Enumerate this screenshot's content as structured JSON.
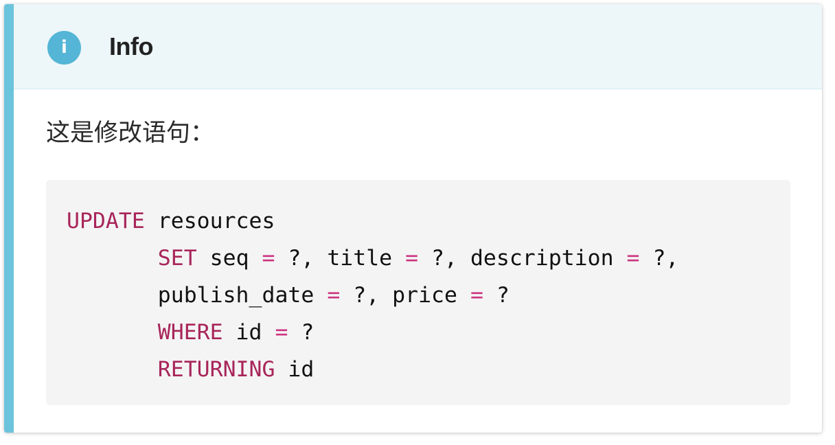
{
  "admonition": {
    "title": "Info",
    "icon": "info-icon",
    "icon_glyph": "i",
    "accent_color": "#6cc3dc",
    "header_bg": "#edf6f9",
    "icon_color": "#54b5d6"
  },
  "content": {
    "lead_text": "这是修改语句："
  },
  "code": {
    "language": "sql",
    "keyword_color": "#a8255a",
    "lines": [
      {
        "indent": "",
        "tokens": [
          {
            "t": "kw",
            "v": "UPDATE"
          },
          {
            "t": "tx",
            "v": " resources"
          }
        ]
      },
      {
        "indent": "       ",
        "tokens": [
          {
            "t": "kw",
            "v": "SET"
          },
          {
            "t": "tx",
            "v": " seq "
          },
          {
            "t": "op",
            "v": "="
          },
          {
            "t": "tx",
            "v": " ?, title "
          },
          {
            "t": "op",
            "v": "="
          },
          {
            "t": "tx",
            "v": " ?, description "
          },
          {
            "t": "op",
            "v": "="
          },
          {
            "t": "tx",
            "v": " ?,"
          }
        ]
      },
      {
        "indent": "       ",
        "tokens": [
          {
            "t": "tx",
            "v": "publish_date "
          },
          {
            "t": "op",
            "v": "="
          },
          {
            "t": "tx",
            "v": " ?, price "
          },
          {
            "t": "op",
            "v": "="
          },
          {
            "t": "tx",
            "v": " ?"
          }
        ]
      },
      {
        "indent": "       ",
        "tokens": [
          {
            "t": "kw",
            "v": "WHERE"
          },
          {
            "t": "tx",
            "v": " id "
          },
          {
            "t": "op",
            "v": "="
          },
          {
            "t": "tx",
            "v": " ?"
          }
        ]
      },
      {
        "indent": "       ",
        "tokens": [
          {
            "t": "kw",
            "v": "RETURNING"
          },
          {
            "t": "tx",
            "v": " id"
          }
        ]
      }
    ]
  }
}
